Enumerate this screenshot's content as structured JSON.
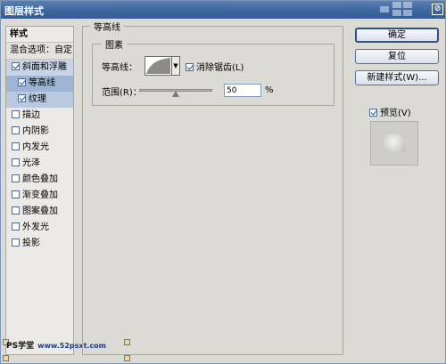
{
  "window": {
    "title": "图层样式",
    "close_glyph": "⊘"
  },
  "left_list": {
    "header": "样式",
    "blend_options": "混合选项：自定",
    "items": [
      {
        "label": "斜面和浮雕",
        "checked": true
      },
      {
        "label": "等高线",
        "checked": true
      },
      {
        "label": "纹理",
        "checked": true
      },
      {
        "label": "描边",
        "checked": false
      },
      {
        "label": "内阴影",
        "checked": false
      },
      {
        "label": "内发光",
        "checked": false
      },
      {
        "label": "光泽",
        "checked": false
      },
      {
        "label": "颜色叠加",
        "checked": false
      },
      {
        "label": "渐变叠加",
        "checked": false
      },
      {
        "label": "图案叠加",
        "checked": false
      },
      {
        "label": "外发光",
        "checked": false
      },
      {
        "label": "投影",
        "checked": false
      }
    ]
  },
  "watermark": {
    "logo": "PS学堂",
    "url": "www.52psxt.com"
  },
  "contour_panel": {
    "group_title": "等高线",
    "sub_title": "图素",
    "contour_label": "等高线：",
    "antialias_label": "消除锯齿(L)",
    "antialias_checked": true,
    "range_label": "范围(R)：",
    "range_value": "50",
    "range_unit": "%",
    "range_fraction": 0.5
  },
  "buttons": {
    "ok": "确定",
    "reset": "复位",
    "new_style": "新建样式(W)...",
    "preview_label": "预览(V)",
    "preview_checked": true
  },
  "colors": {
    "titlebar": "#3e66a0",
    "selection": "#9db4d4",
    "button_border": "#4f6f9f"
  }
}
